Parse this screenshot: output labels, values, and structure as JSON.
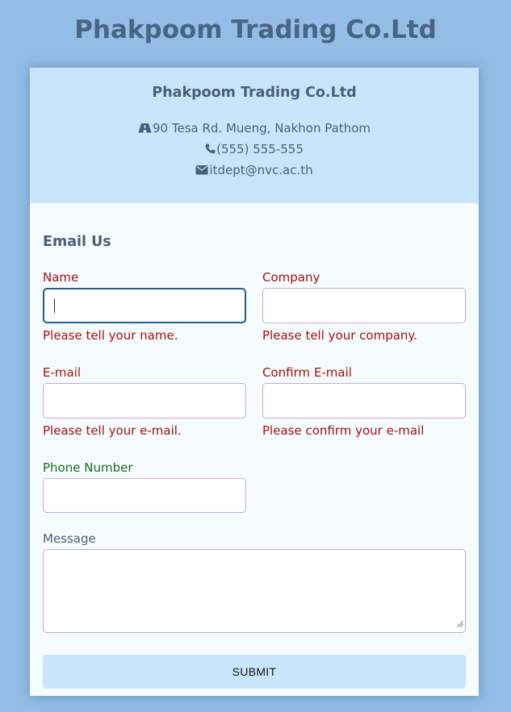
{
  "page_title": "Phakpoom Trading Co.Ltd",
  "header": {
    "company_name": "Phakpoom Trading Co.Ltd",
    "address": "90 Tesa Rd. Mueng, Nakhon Pathom",
    "phone": "(555) 555-555",
    "email": "itdept@nvc.ac.th",
    "icons": {
      "address": "building-icon",
      "phone": "phone-icon",
      "email": "envelope-icon"
    }
  },
  "form": {
    "title": "Email Us",
    "fields": {
      "name": {
        "label": "Name",
        "value": "",
        "error": "Please tell your name."
      },
      "company": {
        "label": "Company",
        "value": "",
        "error": "Please tell your company."
      },
      "email": {
        "label": "E-mail",
        "value": "",
        "error": "Please tell your e-mail."
      },
      "confirm_email": {
        "label": "Confirm E-mail",
        "value": "",
        "error": "Please confirm your e-mail"
      },
      "phone": {
        "label": "Phone Number",
        "value": ""
      },
      "message": {
        "label": "Message",
        "value": ""
      }
    },
    "submit_label": "SUBMIT"
  },
  "colors": {
    "page_background": "#93bde6",
    "header_background": "#c8e5fc",
    "error": "#a31010",
    "valid": "#1d6b26",
    "focus_border": "#1e5f94",
    "input_border": "#c7a8e2"
  }
}
